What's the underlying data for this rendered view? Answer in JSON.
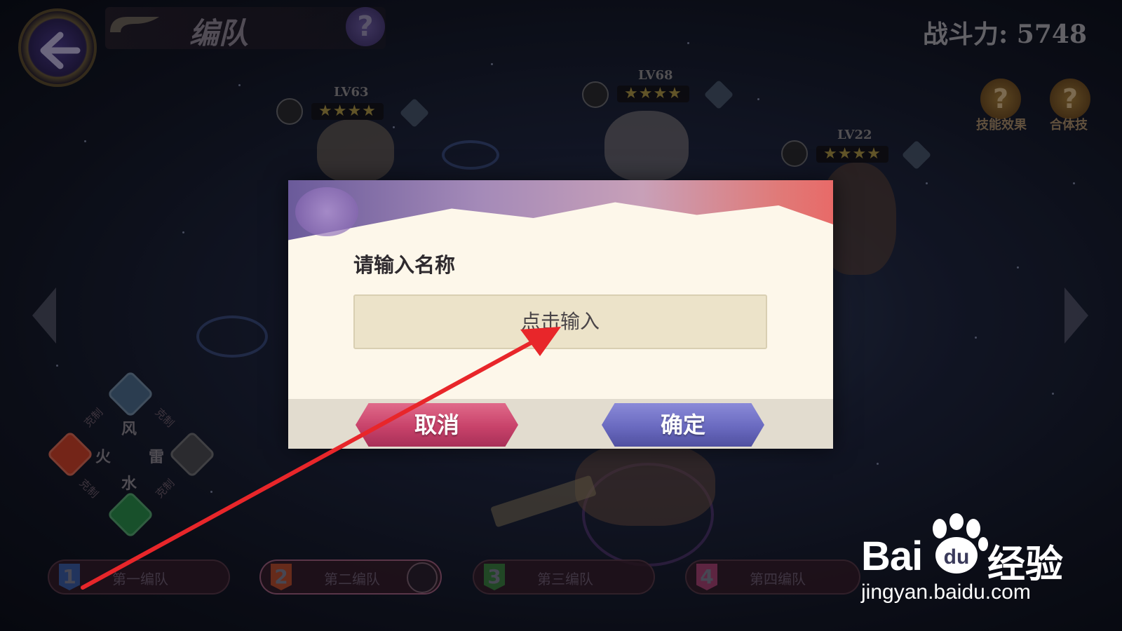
{
  "header": {
    "title": "编队",
    "help_icon": "?",
    "combat_power": "战斗力: 5748"
  },
  "side_help": [
    {
      "icon": "?",
      "label": "技能效果"
    },
    {
      "icon": "?",
      "label": "合体技"
    }
  ],
  "characters": [
    {
      "level": "LV63",
      "stars": "★★★★"
    },
    {
      "level": "LV68",
      "stars": "★★★★"
    },
    {
      "level": "LV22",
      "stars": "★★★★"
    }
  ],
  "element_chart": {
    "wind": "风",
    "fire": "火",
    "thunder": "雷",
    "water": "水",
    "restrain": "克制"
  },
  "teams": [
    {
      "num": "1",
      "label": "第一编队"
    },
    {
      "num": "2",
      "label": "第二编队"
    },
    {
      "num": "3",
      "label": "第三编队"
    },
    {
      "num": "4",
      "label": "第四编队"
    }
  ],
  "dialog": {
    "title": "请输入名称",
    "input_placeholder": "点击输入",
    "cancel_label": "取消",
    "confirm_label": "确定"
  },
  "watermark": {
    "logo": "Bai",
    "logo_tail": "du",
    "brand": "经验",
    "url": "jingyan.baidu.com"
  },
  "colors": {
    "annotation_arrow": "#e8262a",
    "cancel_button": "#c8426a",
    "confirm_button": "#6a6ac0",
    "dialog_bg": "#fdf7ea"
  }
}
